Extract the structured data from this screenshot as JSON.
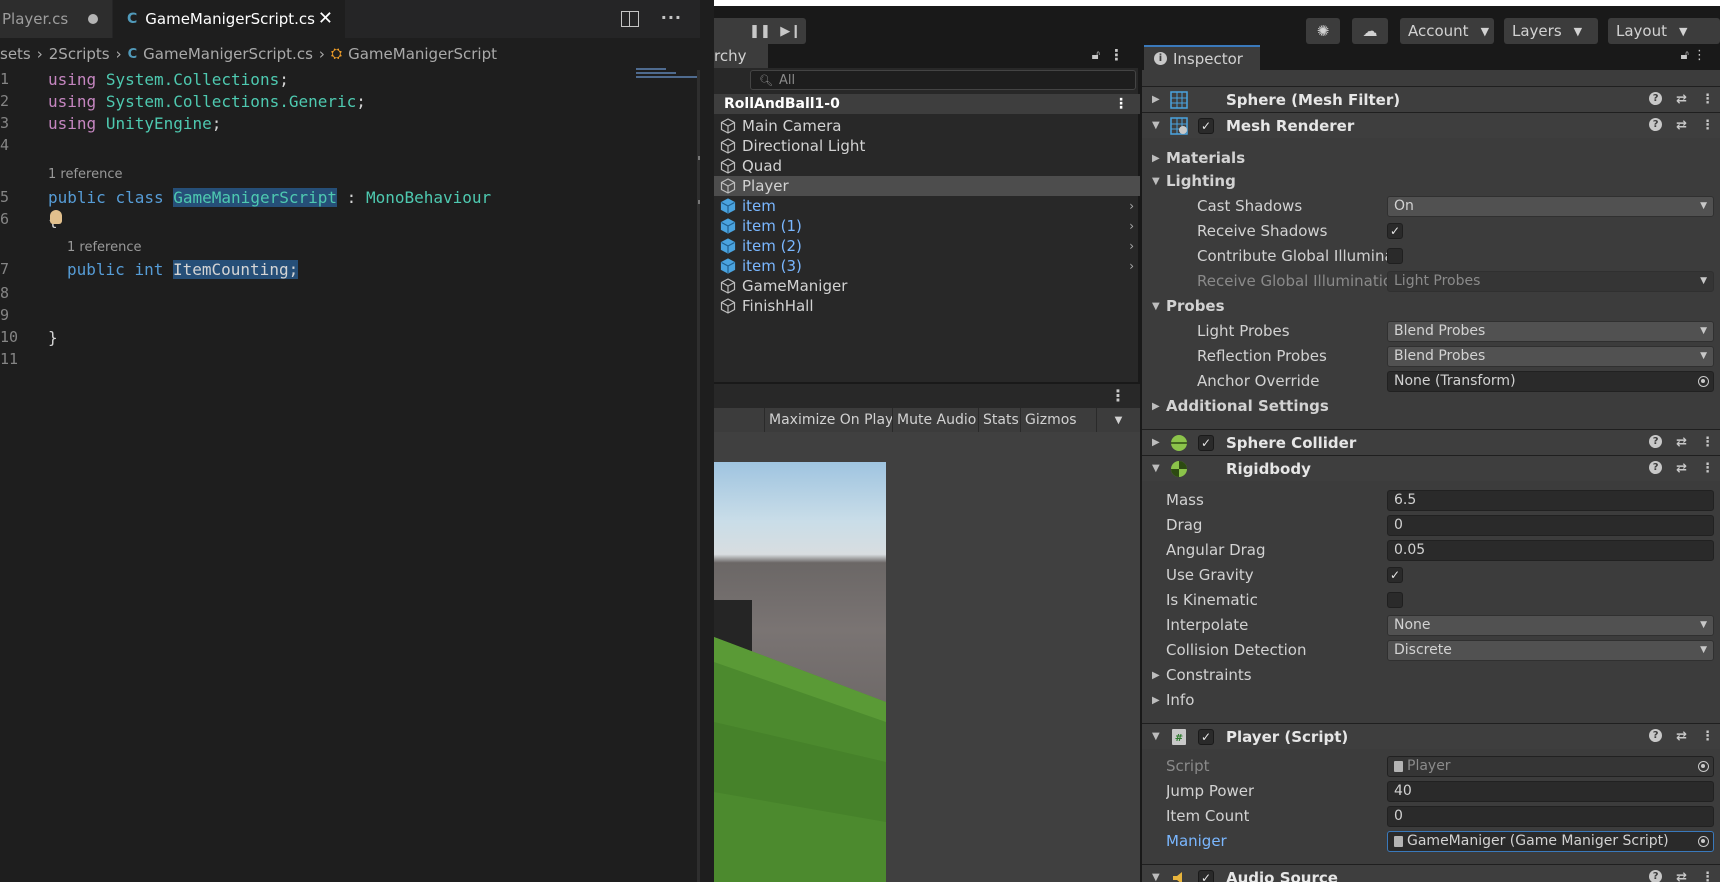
{
  "vscode": {
    "tabs": [
      {
        "label": "Player.cs",
        "dirty": true
      },
      {
        "label": "GameManigerScript.cs",
        "icon": "C",
        "active": true
      }
    ],
    "breadcrumb": [
      "sets",
      "2Scripts",
      "GameManigerScript.cs",
      "GameManigerScript"
    ],
    "code_lines": [
      {
        "n": "1",
        "using": "using",
        "ns": "System.Collections",
        "end": ";"
      },
      {
        "n": "2",
        "using": "using",
        "ns": "System.Collections.Generic",
        "end": ";"
      },
      {
        "n": "3",
        "using": "using",
        "ns": "UnityEngine",
        "end": ";"
      },
      {
        "n": "4"
      },
      {
        "n": "5",
        "kw1": "public",
        "kw2": "class",
        "name": "GameManigerScript",
        "colon": ":",
        "base": "MonoBehaviour"
      },
      {
        "n": "6",
        "text": "{"
      },
      {
        "n": "7",
        "kw1": "public",
        "kw2": "int",
        "field": "ItemCounting;"
      },
      {
        "n": "8"
      },
      {
        "n": "9"
      },
      {
        "n": "10",
        "text": "}"
      },
      {
        "n": "11"
      }
    ],
    "codelens": [
      "1 reference",
      "1 reference"
    ]
  },
  "unity": {
    "toolbar": {
      "account": "Account",
      "layers": "Layers",
      "layout": "Layout"
    },
    "hierarchy": {
      "tab": "rchy",
      "search_placeholder": "All",
      "root": "RollAndBall1-0",
      "items": [
        {
          "label": "Main Camera",
          "prefab": false
        },
        {
          "label": "Directional Light",
          "prefab": false
        },
        {
          "label": "Quad",
          "prefab": false
        },
        {
          "label": "Player",
          "prefab": false,
          "selected": true
        },
        {
          "label": "item",
          "prefab": true
        },
        {
          "label": "item (1)",
          "prefab": true
        },
        {
          "label": "item (2)",
          "prefab": true
        },
        {
          "label": "item (3)",
          "prefab": true
        },
        {
          "label": "GameManiger",
          "prefab": false
        },
        {
          "label": "FinishHall",
          "prefab": false
        }
      ]
    },
    "game": {
      "maximize": "Maximize On Play",
      "mute": "Mute Audio",
      "stats": "Stats",
      "gizmos": "Gizmos"
    },
    "inspector": {
      "tab": "Inspector",
      "mesh_filter": "Sphere (Mesh Filter)",
      "mesh_renderer": "Mesh Renderer",
      "materials": "Materials",
      "lighting": "Lighting",
      "cast_shadows": {
        "label": "Cast Shadows",
        "value": "On"
      },
      "receive_shadows": {
        "label": "Receive Shadows",
        "checked": true
      },
      "contribute_gi": {
        "label": "Contribute Global Illuminatio",
        "checked": false
      },
      "receive_gi": {
        "label": "Receive Global Illumination",
        "value": "Light Probes"
      },
      "probes": "Probes",
      "light_probes": {
        "label": "Light Probes",
        "value": "Blend Probes"
      },
      "reflection_probes": {
        "label": "Reflection Probes",
        "value": "Blend Probes"
      },
      "anchor_override": {
        "label": "Anchor Override",
        "value": "None (Transform)"
      },
      "additional_settings": "Additional Settings",
      "sphere_collider": "Sphere Collider",
      "rigidbody": "Rigidbody",
      "mass": {
        "label": "Mass",
        "value": "6.5"
      },
      "drag": {
        "label": "Drag",
        "value": "0"
      },
      "angular_drag": {
        "label": "Angular Drag",
        "value": "0.05"
      },
      "use_gravity": {
        "label": "Use Gravity",
        "checked": true
      },
      "is_kinematic": {
        "label": "Is Kinematic",
        "checked": false
      },
      "interpolate": {
        "label": "Interpolate",
        "value": "None"
      },
      "collision_detection": {
        "label": "Collision Detection",
        "value": "Discrete"
      },
      "constraints": "Constraints",
      "info": "Info",
      "player_script": "Player (Script)",
      "script": {
        "label": "Script",
        "value": "Player"
      },
      "jump_power": {
        "label": "Jump Power",
        "value": "40"
      },
      "item_count": {
        "label": "Item Count",
        "value": "0"
      },
      "maniger": {
        "label": "Maniger",
        "value": "GameManiger (Game Maniger Script)"
      },
      "audio_source": "Audio Source"
    }
  }
}
